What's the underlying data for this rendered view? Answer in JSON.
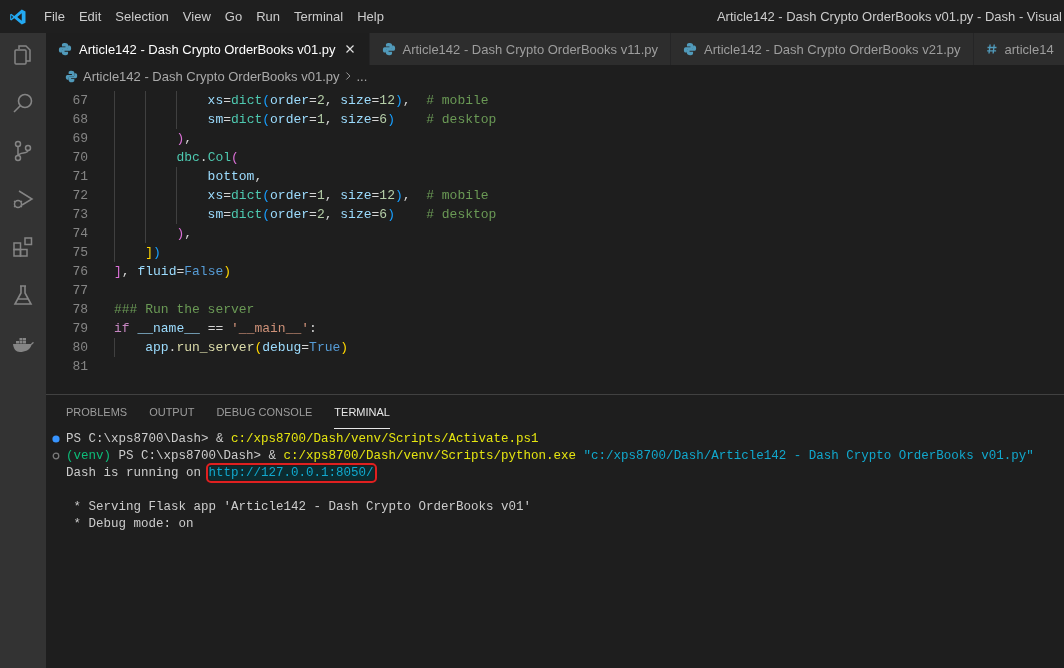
{
  "window": {
    "title": "Article142 - Dash Crypto OrderBooks v01.py - Dash - Visual"
  },
  "menu": [
    "File",
    "Edit",
    "Selection",
    "View",
    "Go",
    "Run",
    "Terminal",
    "Help"
  ],
  "tabs": [
    {
      "label": "Article142 - Dash Crypto OrderBooks v01.py",
      "kind": "python",
      "selected": true
    },
    {
      "label": "Article142 - Dash Crypto OrderBooks v11.py",
      "kind": "python",
      "selected": false
    },
    {
      "label": "Article142 - Dash Crypto OrderBooks v21.py",
      "kind": "python",
      "selected": false
    },
    {
      "label": "article14",
      "kind": "css",
      "selected": false
    }
  ],
  "breadcrumb": {
    "file": "Article142 - Dash Crypto OrderBooks v01.py",
    "more": "..."
  },
  "editor": {
    "lines": [
      {
        "number": "67",
        "tokens": [
          {
            "text": "            xs",
            "kind": "variable"
          },
          {
            "text": "=",
            "kind": "plain"
          },
          {
            "text": "dict",
            "kind": "class"
          },
          {
            "text": "(",
            "kind": "bracket3"
          },
          {
            "text": "order",
            "kind": "variable"
          },
          {
            "text": "=",
            "kind": "plain"
          },
          {
            "text": "2",
            "kind": "number"
          },
          {
            "text": ", ",
            "kind": "plain"
          },
          {
            "text": "size",
            "kind": "variable"
          },
          {
            "text": "=",
            "kind": "plain"
          },
          {
            "text": "12",
            "kind": "number"
          },
          {
            "text": ")",
            "kind": "bracket3"
          },
          {
            "text": ",",
            "kind": "plain"
          },
          {
            "text": "  # mobile",
            "kind": "comment"
          }
        ]
      },
      {
        "number": "68",
        "tokens": [
          {
            "text": "            sm",
            "kind": "variable"
          },
          {
            "text": "=",
            "kind": "plain"
          },
          {
            "text": "dict",
            "kind": "class"
          },
          {
            "text": "(",
            "kind": "bracket3"
          },
          {
            "text": "order",
            "kind": "variable"
          },
          {
            "text": "=",
            "kind": "plain"
          },
          {
            "text": "1",
            "kind": "number"
          },
          {
            "text": ", ",
            "kind": "plain"
          },
          {
            "text": "size",
            "kind": "variable"
          },
          {
            "text": "=",
            "kind": "plain"
          },
          {
            "text": "6",
            "kind": "number"
          },
          {
            "text": ")",
            "kind": "bracket3"
          },
          {
            "text": "    # desktop",
            "kind": "comment"
          }
        ]
      },
      {
        "number": "69",
        "tokens": [
          {
            "text": "        )",
            "kind": "bracket2"
          },
          {
            "text": ",",
            "kind": "plain"
          }
        ]
      },
      {
        "number": "70",
        "tokens": [
          {
            "text": "        dbc",
            "kind": "class"
          },
          {
            "text": ".",
            "kind": "plain"
          },
          {
            "text": "Col",
            "kind": "class"
          },
          {
            "text": "(",
            "kind": "bracket2"
          }
        ]
      },
      {
        "number": "71",
        "tokens": [
          {
            "text": "            bottom",
            "kind": "variable"
          },
          {
            "text": ",",
            "kind": "plain"
          }
        ]
      },
      {
        "number": "72",
        "tokens": [
          {
            "text": "            xs",
            "kind": "variable"
          },
          {
            "text": "=",
            "kind": "plain"
          },
          {
            "text": "dict",
            "kind": "class"
          },
          {
            "text": "(",
            "kind": "bracket3"
          },
          {
            "text": "order",
            "kind": "variable"
          },
          {
            "text": "=",
            "kind": "plain"
          },
          {
            "text": "1",
            "kind": "number"
          },
          {
            "text": ", ",
            "kind": "plain"
          },
          {
            "text": "size",
            "kind": "variable"
          },
          {
            "text": "=",
            "kind": "plain"
          },
          {
            "text": "12",
            "kind": "number"
          },
          {
            "text": ")",
            "kind": "bracket3"
          },
          {
            "text": ",",
            "kind": "plain"
          },
          {
            "text": "  # mobile",
            "kind": "comment"
          }
        ]
      },
      {
        "number": "73",
        "tokens": [
          {
            "text": "            sm",
            "kind": "variable"
          },
          {
            "text": "=",
            "kind": "plain"
          },
          {
            "text": "dict",
            "kind": "class"
          },
          {
            "text": "(",
            "kind": "bracket3"
          },
          {
            "text": "order",
            "kind": "variable"
          },
          {
            "text": "=",
            "kind": "plain"
          },
          {
            "text": "2",
            "kind": "number"
          },
          {
            "text": ", ",
            "kind": "plain"
          },
          {
            "text": "size",
            "kind": "variable"
          },
          {
            "text": "=",
            "kind": "plain"
          },
          {
            "text": "6",
            "kind": "number"
          },
          {
            "text": ")",
            "kind": "bracket3"
          },
          {
            "text": "    # desktop",
            "kind": "comment"
          }
        ]
      },
      {
        "number": "74",
        "tokens": [
          {
            "text": "        )",
            "kind": "bracket2"
          },
          {
            "text": ",",
            "kind": "plain"
          }
        ]
      },
      {
        "number": "75",
        "tokens": [
          {
            "text": "    ]",
            "kind": "bracket1"
          },
          {
            "text": ")",
            "kind": "bracket3"
          }
        ]
      },
      {
        "number": "76",
        "tokens": [
          {
            "text": "]",
            "kind": "bracket2"
          },
          {
            "text": ", ",
            "kind": "plain"
          },
          {
            "text": "fluid",
            "kind": "variable"
          },
          {
            "text": "=",
            "kind": "plain"
          },
          {
            "text": "False",
            "kind": "constant"
          },
          {
            "text": ")",
            "kind": "bracket1"
          }
        ]
      },
      {
        "number": "77"
      },
      {
        "number": "78",
        "tokens": [
          {
            "text": "### Run the server",
            "kind": "comment"
          }
        ]
      },
      {
        "number": "79",
        "tokens": [
          {
            "text": "if ",
            "kind": "keyword"
          },
          {
            "text": "__name__",
            "kind": "variable"
          },
          {
            "text": " == ",
            "kind": "plain"
          },
          {
            "text": "'__main__'",
            "kind": "string"
          },
          {
            "text": ":",
            "kind": "plain"
          }
        ]
      },
      {
        "number": "80",
        "tokens": [
          {
            "text": "    app",
            "kind": "variable"
          },
          {
            "text": ".",
            "kind": "plain"
          },
          {
            "text": "run_server",
            "kind": "function"
          },
          {
            "text": "(",
            "kind": "bracket1"
          },
          {
            "text": "debug",
            "kind": "variable"
          },
          {
            "text": "=",
            "kind": "plain"
          },
          {
            "text": "True",
            "kind": "constant"
          },
          {
            "text": ")",
            "kind": "bracket1"
          }
        ]
      },
      {
        "number": "81"
      }
    ]
  },
  "panel_tabs": [
    {
      "label": "PROBLEMS",
      "selected": false
    },
    {
      "label": "OUTPUT",
      "selected": false
    },
    {
      "label": "DEBUG CONSOLE",
      "selected": false
    },
    {
      "label": "TERMINAL",
      "selected": true
    }
  ],
  "terminal": {
    "lines": [
      {
        "kind": "command",
        "succeeded": true,
        "segments": [
          {
            "text": "PS C:\\xps8700\\Dash> & ",
            "kind": "plain"
          },
          {
            "text": "c:/xps8700/Dash/venv/Scripts/Activate.ps1",
            "kind": "path"
          }
        ]
      },
      {
        "kind": "command",
        "succeeded": false,
        "segments": [
          {
            "text": "(venv)",
            "kind": "env"
          },
          {
            "text": " PS C:\\xps8700\\Dash> & ",
            "kind": "plain"
          },
          {
            "text": "c:/xps8700/Dash/venv/Scripts/python.exe",
            "kind": "path"
          },
          {
            "text": " \"c:/xps8700/Dash/Article142 - Dash Crypto OrderBooks v01.py\"",
            "kind": "string"
          }
        ]
      },
      {
        "segments": [
          {
            "text": "Dash is running on ",
            "kind": "plain"
          },
          {
            "text": "http://127.0.0.1:8050/",
            "kind": "link",
            "highlighted": true
          }
        ]
      },
      {
        "blank_before": true,
        "segments": [
          {
            "text": " * Serving Flask app 'Article142 - Dash Crypto OrderBooks v01'",
            "kind": "plain"
          }
        ]
      },
      {
        "segments": [
          {
            "text": " * Debug mode: on",
            "kind": "plain"
          }
        ]
      }
    ]
  }
}
